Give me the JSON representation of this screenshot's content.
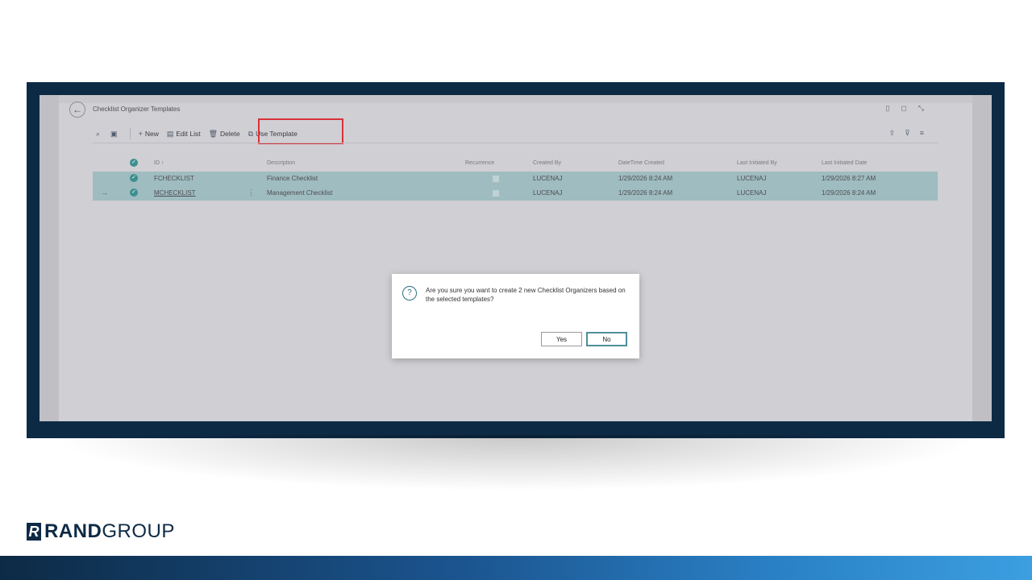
{
  "page": {
    "title": "Checklist Organizer Templates"
  },
  "actions": {
    "new": "New",
    "edit_list": "Edit List",
    "delete": "Delete",
    "use_template": "Use Template"
  },
  "table": {
    "headers": {
      "id": "ID ↑",
      "description": "Description",
      "recurrence": "Recurrence",
      "created_by": "Created By",
      "datetime_created": "DateTime Created",
      "last_initiated_by": "Last Initiated By",
      "last_initiated_date": "Last Initiated Date"
    },
    "rows": [
      {
        "id": "FCHECKLIST",
        "description": "Finance Checklist",
        "created_by": "LUCENAJ",
        "datetime_created": "1/29/2026 8:24 AM",
        "last_initiated_by": "LUCENAJ",
        "last_initiated_date": "1/29/2026 8:27 AM"
      },
      {
        "id": "MCHECKLIST",
        "description": "Management Checklist",
        "created_by": "LUCENAJ",
        "datetime_created": "1/29/2026 8:24 AM",
        "last_initiated_by": "LUCENAJ",
        "last_initiated_date": "1/29/2026 8:24 AM"
      }
    ]
  },
  "dialog": {
    "message": "Are you sure you want to create 2 new Checklist Organizers based on the selected templates?",
    "yes": "Yes",
    "no": "No"
  },
  "brand": {
    "rand": "RAND",
    "group": "GROUP"
  },
  "colors": {
    "frame": "#0d2a45",
    "selection": "#9fbcc0",
    "highlight": "#d9313a"
  }
}
